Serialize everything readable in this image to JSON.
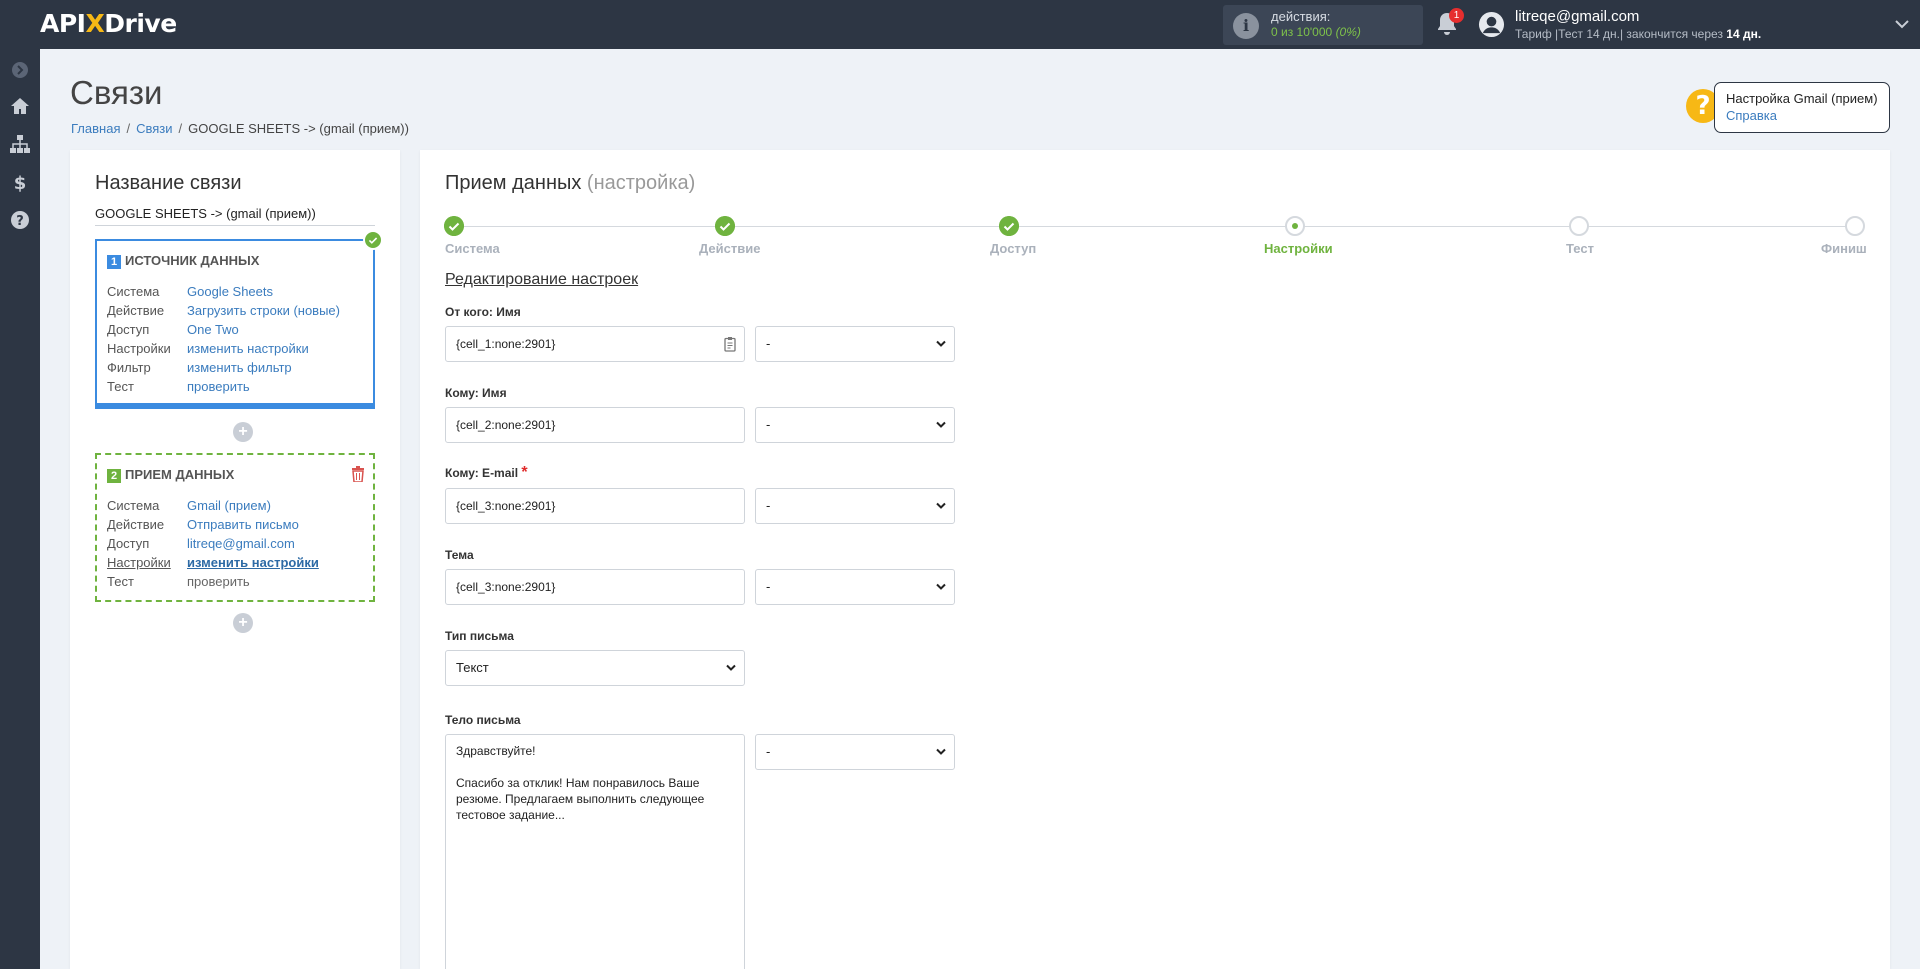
{
  "app": {
    "logo_left": "API",
    "logo_x": "X",
    "logo_right": "Drive"
  },
  "topbar": {
    "actions_label": "действия:",
    "actions_count": "0 из 10'000",
    "actions_percent": "(0%)",
    "notifications_count": "1",
    "user_email": "litreqe@gmail.com",
    "plan_prefix": "Тариф |Тест 14 дн.| закончится через ",
    "plan_days": "14 дн."
  },
  "page": {
    "title": "Связи",
    "breadcrumb": [
      "Главная",
      "Связи",
      "GOOGLE SHEETS -> (gmail (прием))"
    ]
  },
  "help": {
    "title": "Настройка Gmail (прием)",
    "link": "Справка"
  },
  "left": {
    "title": "Название связи",
    "connection_name": "GOOGLE SHEETS -> (gmail (прием))",
    "source": {
      "num": "1",
      "heading": "ИСТОЧНИК ДАННЫХ",
      "rows": [
        {
          "k": "Система",
          "v": "Google Sheets"
        },
        {
          "k": "Действие",
          "v": "Загрузить строки (новые)"
        },
        {
          "k": "Доступ",
          "v": "One Two"
        },
        {
          "k": "Настройки",
          "v": "изменить настройки"
        },
        {
          "k": "Фильтр",
          "v": "изменить фильтр"
        },
        {
          "k": "Тест",
          "v": "проверить"
        }
      ]
    },
    "receiver": {
      "num": "2",
      "heading": "ПРИЕМ ДАННЫХ",
      "rows": [
        {
          "k": "Система",
          "v": "Gmail (прием)"
        },
        {
          "k": "Действие",
          "v": "Отправить письмо"
        },
        {
          "k": "Доступ",
          "v": "litreqe@gmail.com"
        },
        {
          "k": "Настройки",
          "v": "изменить настройки"
        },
        {
          "k": "Тест",
          "v": "проверить"
        }
      ]
    }
  },
  "main": {
    "title": "Прием данных",
    "title_sub": "(настройка)",
    "steps": [
      "Система",
      "Действие",
      "Доступ",
      "Настройки",
      "Тест",
      "Финиш"
    ],
    "current_step": 3,
    "edit_title": "Редактирование настроек",
    "fields": {
      "from_name": {
        "label": "От кого: Имя",
        "value": "{cell_1:none:2901}",
        "select": "-"
      },
      "to_name": {
        "label": "Кому: Имя",
        "value": "{cell_2:none:2901}",
        "select": "-"
      },
      "to_email": {
        "label": "Кому: E-mail",
        "value": "{cell_3:none:2901}",
        "select": "-"
      },
      "subject": {
        "label": "Тема",
        "value": "{cell_3:none:2901}",
        "select": "-"
      },
      "mail_type": {
        "label": "Тип письма",
        "value": "Текст"
      },
      "body": {
        "label": "Тело письма",
        "value": "Здравствуйте!\n\nСпасибо за отклик! Нам понравилось Ваше резюме. Предлагаем выполнить следующее тестовое задание...",
        "select": "-"
      }
    }
  },
  "colors": {
    "topbar": "#2d3644",
    "accent_green": "#6fb33f",
    "accent_blue": "#3b8be0",
    "link": "#3b7cbe",
    "brand_yellow": "#f7b815"
  }
}
